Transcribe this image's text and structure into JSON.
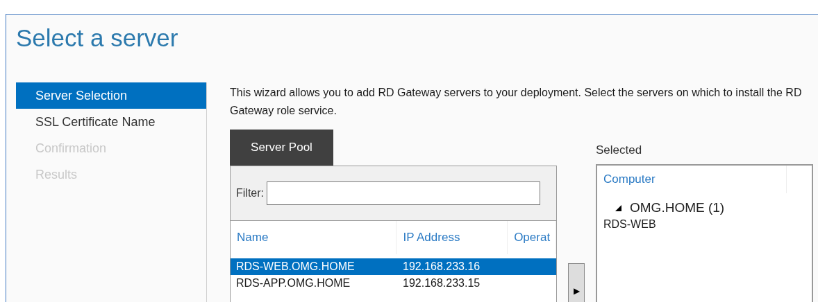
{
  "window": {
    "title": "Select a server"
  },
  "steps": [
    {
      "label": "Server Selection",
      "selected": true,
      "disabled": false
    },
    {
      "label": "SSL Certificate Name",
      "selected": false,
      "disabled": false
    },
    {
      "label": "Confirmation",
      "selected": false,
      "disabled": true
    },
    {
      "label": "Results",
      "selected": false,
      "disabled": true
    }
  ],
  "description": "This wizard allows you to add RD Gateway servers to your deployment. Select the servers on which to install the RD Gateway role service.",
  "tabs": [
    {
      "label": "Server Pool",
      "selected": true
    }
  ],
  "filter": {
    "label": "Filter:"
  },
  "server_table": {
    "columns": [
      "Name",
      "IP Address",
      "Operat"
    ],
    "rows": [
      {
        "cells": [
          "RDS-WEB.OMG.HOME",
          "192.168.233.16"
        ],
        "selected": true
      },
      {
        "cells": [
          "RDS-APP.OMG.HOME",
          "192.168.233.15"
        ],
        "selected": false
      }
    ]
  },
  "add_button": {
    "label": "▶"
  },
  "selected_panel": {
    "label": "Selected",
    "columns": [
      "Computer"
    ],
    "groups": [
      {
        "label": "OMG.HOME (1)",
        "expanded": true,
        "children": [
          {
            "label": "RDS-WEB"
          }
        ]
      }
    ]
  }
}
